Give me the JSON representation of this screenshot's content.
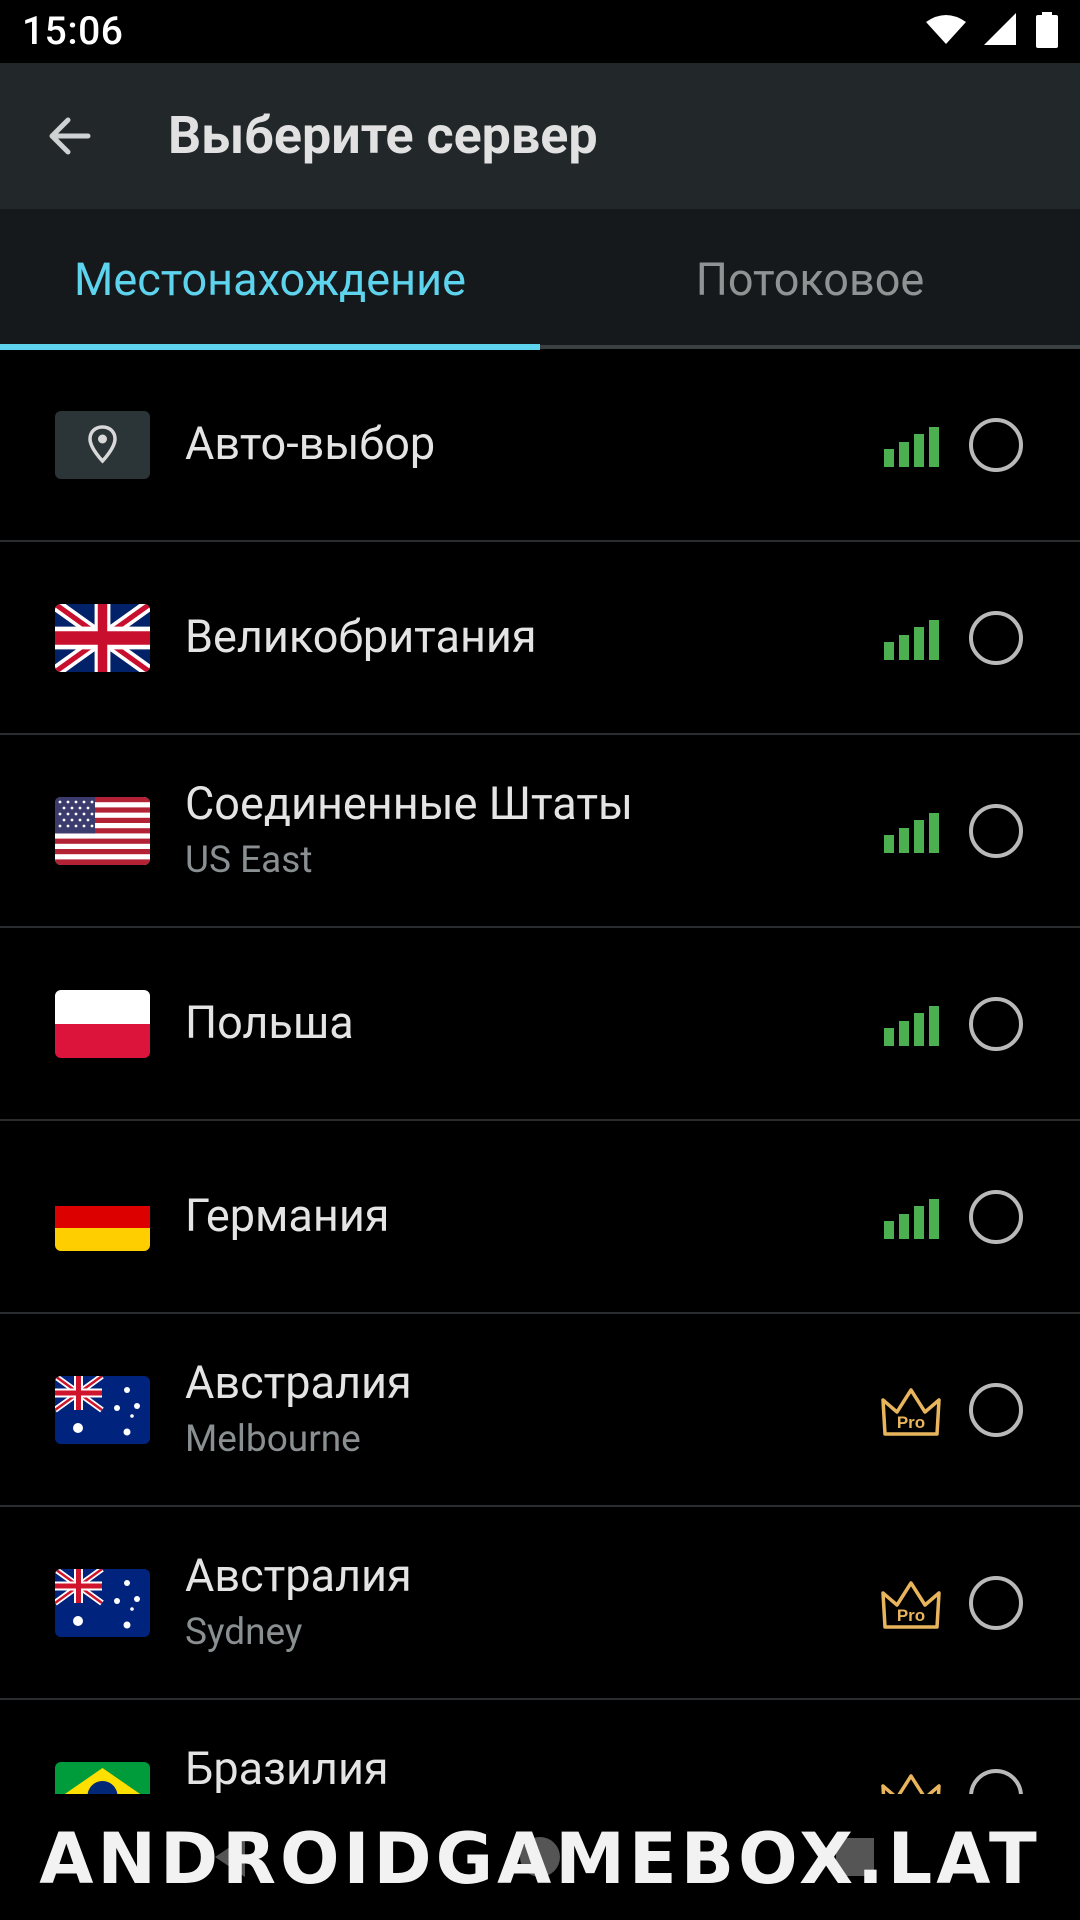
{
  "status_bar": {
    "time": "15:06"
  },
  "app_bar": {
    "title": "Выберите сервер"
  },
  "tabs": [
    {
      "label": "Местонахождение",
      "active": true
    },
    {
      "label": "Потоковое",
      "active": false
    }
  ],
  "colors": {
    "accent": "#5ed3ee",
    "signal": "#4caf50",
    "pro": "#e8b55c"
  },
  "servers": [
    {
      "name": "Авто-выбор",
      "sub": "",
      "flag": "location-pin",
      "status": "signal-full"
    },
    {
      "name": "Великобритания",
      "sub": "",
      "flag": "uk-flag",
      "status": "signal-full"
    },
    {
      "name": "Соединенные Штаты",
      "sub": "US East",
      "flag": "us-flag",
      "status": "signal-full"
    },
    {
      "name": "Польша",
      "sub": "",
      "flag": "poland-flag",
      "status": "signal-full"
    },
    {
      "name": "Германия",
      "sub": "",
      "flag": "germany-flag",
      "status": "signal-full"
    },
    {
      "name": "Австралия",
      "sub": "Melbourne",
      "flag": "australia-flag",
      "status": "pro-crown"
    },
    {
      "name": "Австралия",
      "sub": "Sydney",
      "flag": "australia-flag",
      "status": "pro-crown"
    },
    {
      "name": "Бразилия",
      "sub": "",
      "flag": "brazil-flag",
      "status": "pro-crown"
    }
  ],
  "pro_badge": "Pro",
  "watermark": "ANDROIDGAMEBOX.LAT"
}
